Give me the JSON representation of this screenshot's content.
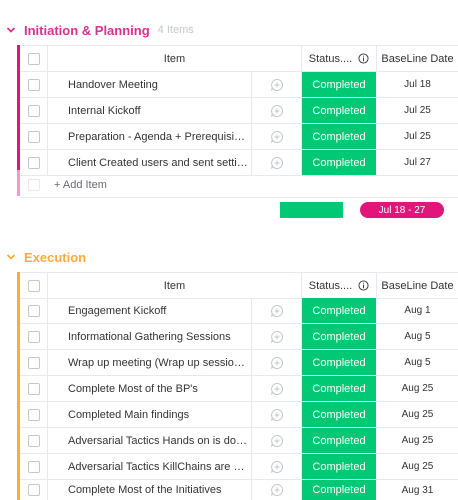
{
  "colors": {
    "planning": "#e2445c",
    "planning_title": "#d9318f",
    "execution": "#fdab3d",
    "execution_title": "#fdab3d",
    "completed": "#00c875",
    "pill": "#e2167a"
  },
  "columns": {
    "item": "Item",
    "status": "Status....",
    "date": "BaseLine Date"
  },
  "groups": [
    {
      "title": "Initiation & Planning",
      "count": "4 Items",
      "rows": [
        {
          "name": "Handover Meeting",
          "status": "Completed",
          "date": "Jul 18"
        },
        {
          "name": "Internal Kickoff",
          "status": "Completed",
          "date": "Jul 25"
        },
        {
          "name": "Preparation - Agenda + Prerequisites",
          "status": "Completed",
          "date": "Jul 25"
        },
        {
          "name": "Client Created users and sent settings",
          "status": "Completed",
          "date": "Jul 27"
        }
      ],
      "add_item": "+ Add Item",
      "summary_range": "Jul 18 - 27"
    },
    {
      "title": "Execution",
      "count": "",
      "rows": [
        {
          "name": "Engagement Kickoff",
          "status": "Completed",
          "date": "Aug 1"
        },
        {
          "name": "Informational Gathering Sessions",
          "status": "Completed",
          "date": "Aug 5"
        },
        {
          "name": "Wrap up meeting (Wrap up sessions)",
          "status": "Completed",
          "date": "Aug 5"
        },
        {
          "name": "Complete Most of the BP's",
          "status": "Completed",
          "date": "Aug 25"
        },
        {
          "name": "Completed Main findings",
          "status": "Completed",
          "date": "Aug 25"
        },
        {
          "name": "Adversarial Tactics Hands on is done",
          "status": "Completed",
          "date": "Aug 25"
        },
        {
          "name": "Adversarial Tactics KillChains are done",
          "status": "Completed",
          "date": "Aug 25"
        },
        {
          "name": "Complete Most of the Initiatives",
          "status": "Completed",
          "date": "Aug 31"
        }
      ]
    }
  ],
  "icons": {
    "collapse": "chevron-down-icon",
    "info": "info-icon",
    "update": "add-update-icon"
  }
}
